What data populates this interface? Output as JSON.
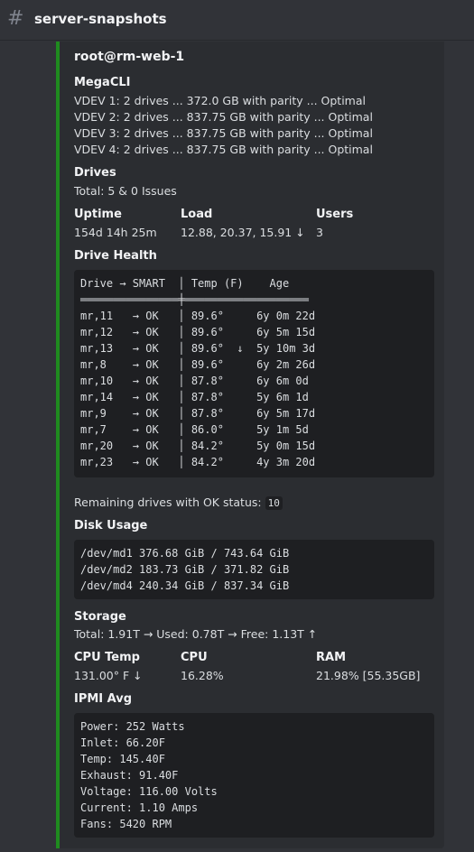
{
  "channel": {
    "name": "server-snapshots"
  },
  "embed": {
    "author": "root@rm-web-1",
    "megacli": {
      "name": "MegaCLI",
      "lines": [
        "VDEV 1: 2 drives ... 372.0 GB with parity ... Optimal",
        "VDEV 2: 2 drives ... 837.75 GB with parity ... Optimal",
        "VDEV 3: 2 drives ... 837.75 GB with parity ... Optimal",
        "VDEV 4: 2 drives ... 837.75 GB with parity ... Optimal"
      ]
    },
    "drives": {
      "name": "Drives",
      "value": "Total: 5 & 0 Issues"
    },
    "uptime": {
      "name": "Uptime",
      "value": "154d 14h 25m"
    },
    "load": {
      "name": "Load",
      "value": "12.88, 20.37, 15.91 ↓"
    },
    "users": {
      "name": "Users",
      "value": "3"
    },
    "drive_health": {
      "name": "Drive Health",
      "header": "Drive → SMART  │ Temp (F)    Age",
      "separator": "═══════════════╪═══════════════════",
      "rows": [
        "mr,11   → OK   │ 89.6°     6y 0m 22d",
        "mr,12   → OK   │ 89.6°     6y 5m 15d",
        "mr,13   → OK   │ 89.6°  ↓  5y 10m 3d",
        "mr,8    → OK   │ 89.6°     6y 2m 26d",
        "mr,10   → OK   │ 87.8°     6y 6m 0d",
        "mr,14   → OK   │ 87.8°     5y 6m 1d",
        "mr,9    → OK   │ 87.8°     6y 5m 17d",
        "mr,7    → OK   │ 86.0°     5y 1m 5d",
        "mr,20   → OK   │ 84.2°     5y 0m 15d",
        "mr,23   → OK   │ 84.2°     4y 3m 20d"
      ]
    },
    "remaining": {
      "text": "Remaining drives with OK status:",
      "count": "10"
    },
    "disk_usage": {
      "name": "Disk Usage",
      "lines": [
        "/dev/md1 376.68 GiB / 743.64 GiB",
        "/dev/md2 183.73 GiB / 371.82 GiB",
        "/dev/md4 240.34 GiB / 837.34 GiB"
      ]
    },
    "storage": {
      "name": "Storage",
      "value": "Total: 1.91T → Used: 0.78T → Free: 1.13T ↑"
    },
    "cpu_temp": {
      "name": "CPU Temp",
      "value": "131.00° F ↓"
    },
    "cpu": {
      "name": "CPU",
      "value": "16.28%"
    },
    "ram": {
      "name": "RAM",
      "value": "21.98% [55.35GB]"
    },
    "ipmi": {
      "name": "IPMI Avg",
      "lines": [
        "Power: 252 Watts",
        "Inlet: 66.20F",
        "Temp: 145.40F",
        "Exhaust: 91.40F",
        "Voltage: 116.00 Volts",
        "Current: 1.10 Amps",
        "Fans: 5420 RPM"
      ]
    }
  },
  "colors": {
    "embed_accent": "#1f8b1f",
    "background": "#313338",
    "embed_bg": "#2b2d31",
    "code_bg": "#1e1f22"
  }
}
